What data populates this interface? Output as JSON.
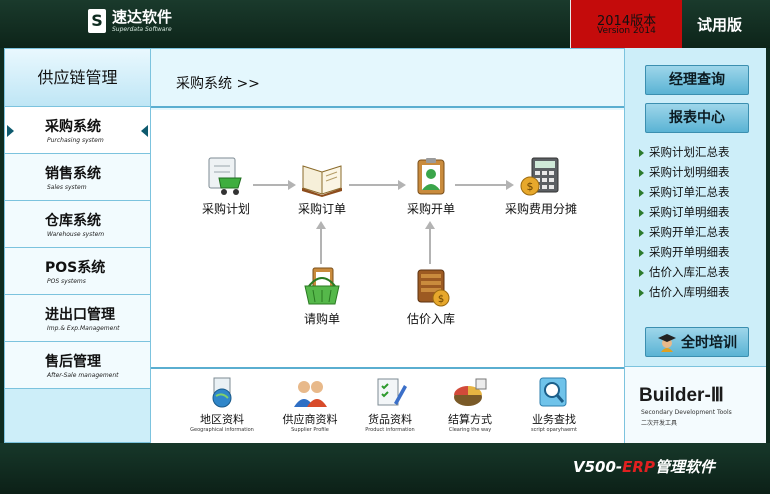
{
  "header": {
    "logo_cn": "速达软件",
    "logo_en": "Superdata Software",
    "logo_mark": "S",
    "version_cn": "2014版本",
    "version_en": "Version 2014",
    "edition": "试用版"
  },
  "left_nav": {
    "title": "供应链管理",
    "items": [
      {
        "cn": "采购系统",
        "en": "Purchasing system",
        "active": true
      },
      {
        "cn": "销售系统",
        "en": "Sales system"
      },
      {
        "cn": "仓库系统",
        "en": "Warehouse system"
      },
      {
        "cn": "POS系统",
        "en": "POS systems"
      },
      {
        "cn": "进出口管理",
        "en": "Imp.& Exp.Management"
      },
      {
        "cn": "售后管理",
        "en": "After-Sale management"
      }
    ]
  },
  "breadcrumb": "采购系统 >>",
  "flow": {
    "nodes": {
      "plan": "采购计划",
      "order": "采购订单",
      "invoice": "采购开单",
      "cost": "采购费用分摊",
      "request": "请购单",
      "estimate": "估价入库"
    }
  },
  "bottom_icons": [
    {
      "cn": "地区资料",
      "en": "Geographical information"
    },
    {
      "cn": "供应商资料",
      "en": "Supplier Profile"
    },
    {
      "cn": "货品资料",
      "en": "Product information"
    },
    {
      "cn": "结算方式",
      "en": "Clearing the way"
    },
    {
      "cn": "业务查找",
      "en": "script oparyhaemt"
    }
  ],
  "right_panel": {
    "manager_query": "经理查询",
    "report_center": "报表中心",
    "reports": [
      "采购计划汇总表",
      "采购计划明细表",
      "采购订单汇总表",
      "采购订单明细表",
      "采购开单汇总表",
      "采购开单明细表",
      "估价入库汇总表",
      "估价入库明细表"
    ],
    "training": "全时培训",
    "builder_title": "Builder-Ⅲ",
    "builder_en": "Secondary Development Tools",
    "builder_cn": "二次开发工具"
  },
  "footer": {
    "prefix": "V500-",
    "erp": "ERP",
    "suffix": "管理软件"
  }
}
